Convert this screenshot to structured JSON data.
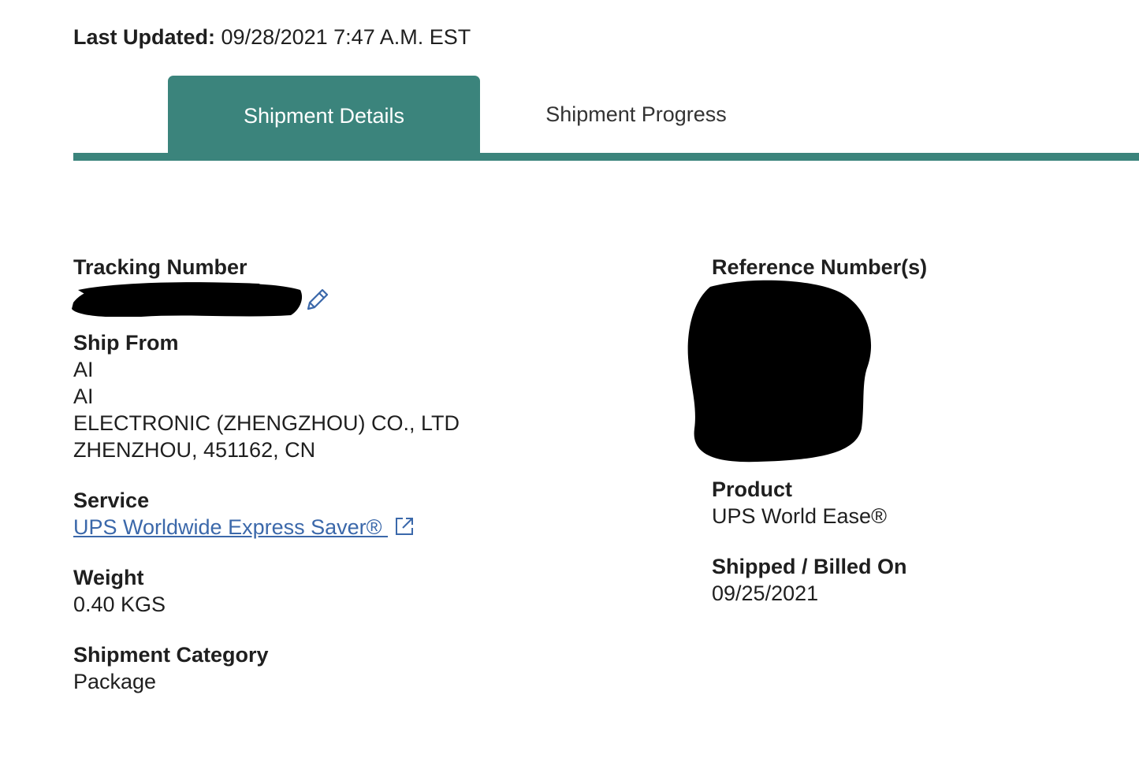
{
  "header": {
    "last_updated_label": "Last Updated:",
    "last_updated_value": "09/28/2021 7:47 A.M. EST"
  },
  "tabs": [
    {
      "label": "Shipment Details",
      "active": true
    },
    {
      "label": "Shipment Progress",
      "active": false
    }
  ],
  "details": {
    "tracking_number": {
      "label": "Tracking Number",
      "value_redacted": true,
      "edit_icon": "pencil-icon"
    },
    "ship_from": {
      "label": "Ship From",
      "lines": [
        "AI",
        "AI",
        "ELECTRONIC (ZHENGZHOU) CO., LTD",
        "ZHENZHOU, 451162, CN"
      ]
    },
    "service": {
      "label": "Service",
      "link_text": "UPS Worldwide Express Saver® ",
      "link_icon": "external-link-icon"
    },
    "weight": {
      "label": "Weight",
      "value": "0.40 KGS"
    },
    "shipment_category": {
      "label": "Shipment Category",
      "value": "Package"
    },
    "reference_numbers": {
      "label": "Reference Number(s)",
      "value_redacted": true
    },
    "product": {
      "label": "Product",
      "value": "UPS World Ease®"
    },
    "shipped_billed_on": {
      "label": "Shipped / Billed On",
      "value": "09/25/2021"
    }
  },
  "colors": {
    "accent": "#3b847c",
    "link": "#3b68aa",
    "text": "#1f1f1f"
  }
}
